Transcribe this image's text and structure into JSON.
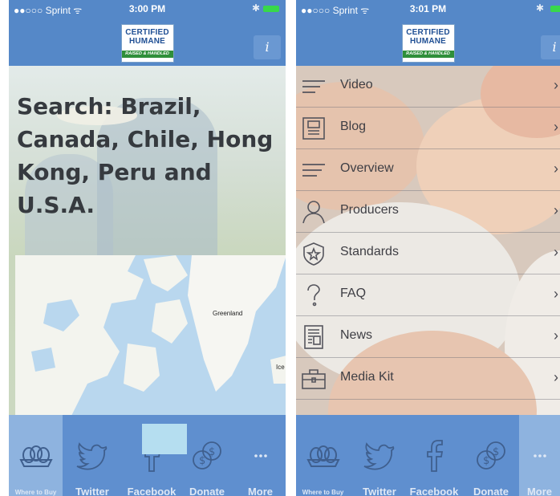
{
  "left_screen": {
    "status_bar": {
      "carrier": "●●○○○ Sprint ᯤ",
      "time": "3:00 PM",
      "bluetooth": "✱"
    },
    "logo": {
      "line1": "CERTIFIED",
      "line2": "HUMANE",
      "line3": "RAISED & HANDLED"
    },
    "info_button": "i",
    "search_heading": "Search: Brazil, Canada, Chile, Hong Kong, Peru and U.S.A.",
    "map": {
      "labels": [
        "Greenland",
        "Ice"
      ]
    },
    "tabs": [
      {
        "label": "Where to Buy",
        "icon": "eggs-icon",
        "selected": true
      },
      {
        "label": "Twitter",
        "icon": "twitter-icon",
        "selected": false
      },
      {
        "label": "Facebook",
        "icon": "facebook-icon",
        "selected": false
      },
      {
        "label": "Donate",
        "icon": "donate-icon",
        "selected": false
      },
      {
        "label": "More",
        "icon": "more-icon",
        "selected": false
      }
    ]
  },
  "right_screen": {
    "status_bar": {
      "carrier": "●●○○○ Sprint ᯤ",
      "time": "3:01 PM",
      "bluetooth": "✱"
    },
    "logo": {
      "line1": "CERTIFIED",
      "line2": "HUMANE",
      "line3": "RAISED & HANDLED"
    },
    "info_button": "i",
    "menu": [
      {
        "label": "Video",
        "icon": "video-icon"
      },
      {
        "label": "Blog",
        "icon": "blog-icon"
      },
      {
        "label": "Overview",
        "icon": "overview-icon"
      },
      {
        "label": "Producers",
        "icon": "producers-icon"
      },
      {
        "label": "Standards",
        "icon": "standards-icon"
      },
      {
        "label": "FAQ",
        "icon": "faq-icon"
      },
      {
        "label": "News",
        "icon": "news-icon"
      },
      {
        "label": "Media Kit",
        "icon": "media-kit-icon"
      }
    ],
    "chevron": "›",
    "tabs": [
      {
        "label": "Where to Buy",
        "icon": "eggs-icon",
        "selected": false
      },
      {
        "label": "Twitter",
        "icon": "twitter-icon",
        "selected": false
      },
      {
        "label": "Facebook",
        "icon": "facebook-icon",
        "selected": false
      },
      {
        "label": "Donate",
        "icon": "donate-icon",
        "selected": false
      },
      {
        "label": "More",
        "icon": "more-icon",
        "selected": true
      }
    ]
  },
  "colors": {
    "nav_blue": "#5588c8",
    "tab_blue": "#5f8fcf",
    "tab_selected": "#8eb3df",
    "logo_blue": "#1f4f94",
    "logo_green": "#2f8f3a"
  }
}
